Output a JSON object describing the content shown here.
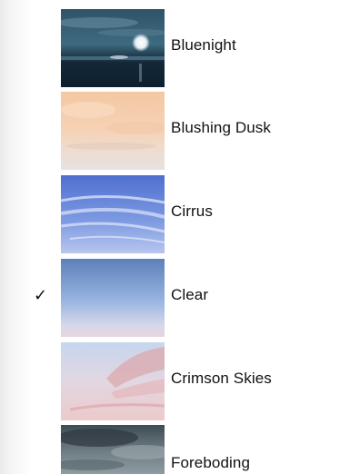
{
  "skybox_menu": {
    "items": [
      {
        "label": "Bluenight",
        "thumbnail": "bluenight-sky",
        "checked": false
      },
      {
        "label": "Blushing Dusk",
        "thumbnail": "blushing-dusk-sky",
        "checked": false
      },
      {
        "label": "Cirrus",
        "thumbnail": "cirrus-sky",
        "checked": false
      },
      {
        "label": "Clear",
        "thumbnail": "clear-sky",
        "checked": true,
        "check_mark": "✓"
      },
      {
        "label": "Crimson Skies",
        "thumbnail": "crimson-skies-sky",
        "checked": false
      },
      {
        "label": "Foreboding",
        "thumbnail": "foreboding-sky",
        "checked": false
      }
    ]
  },
  "colors": {
    "bluenight": "#1f3a4f",
    "blushing_dusk": "#f2c9a5",
    "cirrus": "#6b8fdc",
    "clear": "#7ea2d8",
    "crimson_skies": "#e7c1c8",
    "foreboding": "#4c5a63"
  }
}
